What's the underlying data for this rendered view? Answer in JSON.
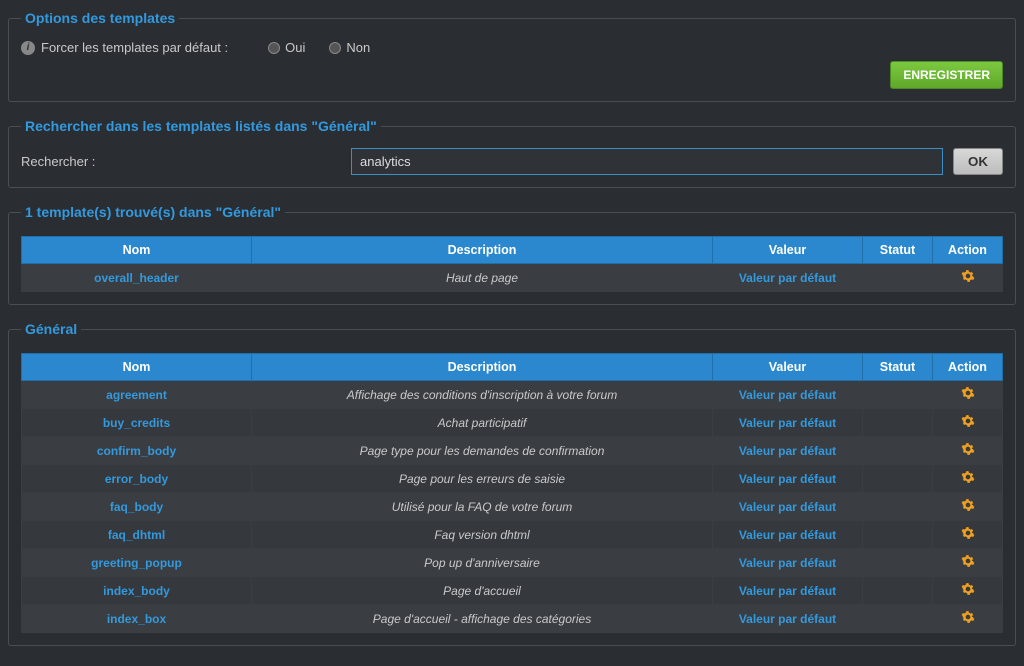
{
  "options": {
    "legend": "Options des templates",
    "force_label": "Forcer les templates par défaut :",
    "yes": "Oui",
    "no": "Non",
    "save": "ENREGISTRER"
  },
  "search": {
    "legend": "Rechercher dans les templates listés dans \"Général\"",
    "label": "Rechercher :",
    "value": "analytics",
    "ok": "OK"
  },
  "results": {
    "legend": "1 template(s) trouvé(s) dans \"Général\"",
    "headers": {
      "name": "Nom",
      "desc": "Description",
      "val": "Valeur",
      "stat": "Statut",
      "act": "Action"
    },
    "rows": [
      {
        "name": "overall_header",
        "desc": "Haut de page",
        "val": "Valeur par défaut"
      }
    ]
  },
  "general": {
    "legend": "Général",
    "headers": {
      "name": "Nom",
      "desc": "Description",
      "val": "Valeur",
      "stat": "Statut",
      "act": "Action"
    },
    "rows": [
      {
        "name": "agreement",
        "desc": "Affichage des conditions d'inscription à votre forum",
        "val": "Valeur par défaut"
      },
      {
        "name": "buy_credits",
        "desc": "Achat participatif",
        "val": "Valeur par défaut"
      },
      {
        "name": "confirm_body",
        "desc": "Page type pour les demandes de confirmation",
        "val": "Valeur par défaut"
      },
      {
        "name": "error_body",
        "desc": "Page pour les erreurs de saisie",
        "val": "Valeur par défaut"
      },
      {
        "name": "faq_body",
        "desc": "Utilisé pour la FAQ de votre forum",
        "val": "Valeur par défaut"
      },
      {
        "name": "faq_dhtml",
        "desc": "Faq version dhtml",
        "val": "Valeur par défaut"
      },
      {
        "name": "greeting_popup",
        "desc": "Pop up d'anniversaire",
        "val": "Valeur par défaut"
      },
      {
        "name": "index_body",
        "desc": "Page d'accueil",
        "val": "Valeur par défaut"
      },
      {
        "name": "index_box",
        "desc": "Page d'accueil - affichage des catégories",
        "val": "Valeur par défaut"
      }
    ]
  }
}
